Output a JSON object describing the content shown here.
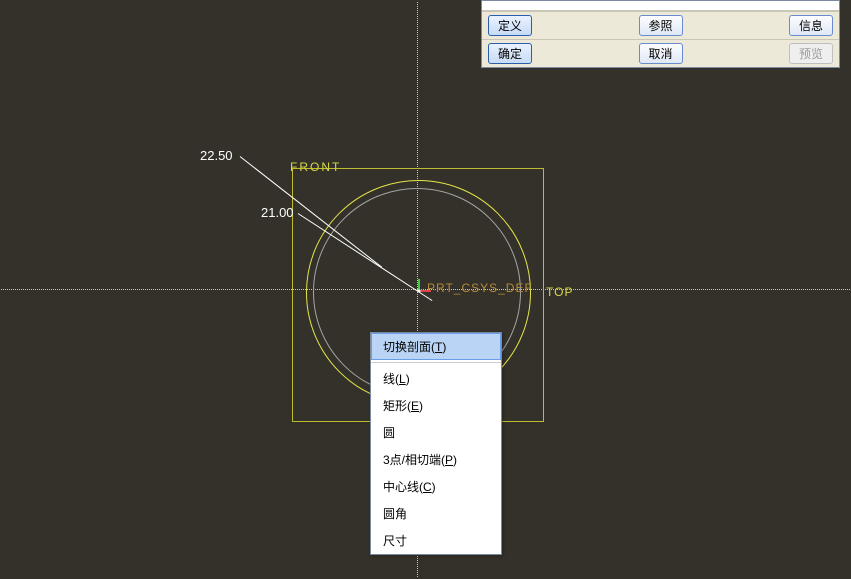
{
  "labels": {
    "front": "FRONT",
    "top": "TOP",
    "csys": "PRT_CSYS_DEF"
  },
  "dimensions": {
    "d1": "22.50",
    "d2": "21.00"
  },
  "dialog": {
    "define": "定义",
    "reference": "参照",
    "info": "信息",
    "ok": "确定",
    "cancel": "取消",
    "preview": "预览"
  },
  "context_menu": {
    "toggle_section": "切换剖面(",
    "toggle_section_key": "T",
    "toggle_section_tail": ")",
    "line": "线(",
    "line_key": "L",
    "line_tail": ")",
    "rectangle": "矩形(",
    "rectangle_key": "E",
    "rectangle_tail": ")",
    "circle": "圆",
    "three_point": "3点/相切端(",
    "three_point_key": "P",
    "three_point_tail": ")",
    "centerline": "中心线(",
    "centerline_key": "C",
    "centerline_tail": ")",
    "fillet": "圆角",
    "dimension": "尺寸"
  }
}
